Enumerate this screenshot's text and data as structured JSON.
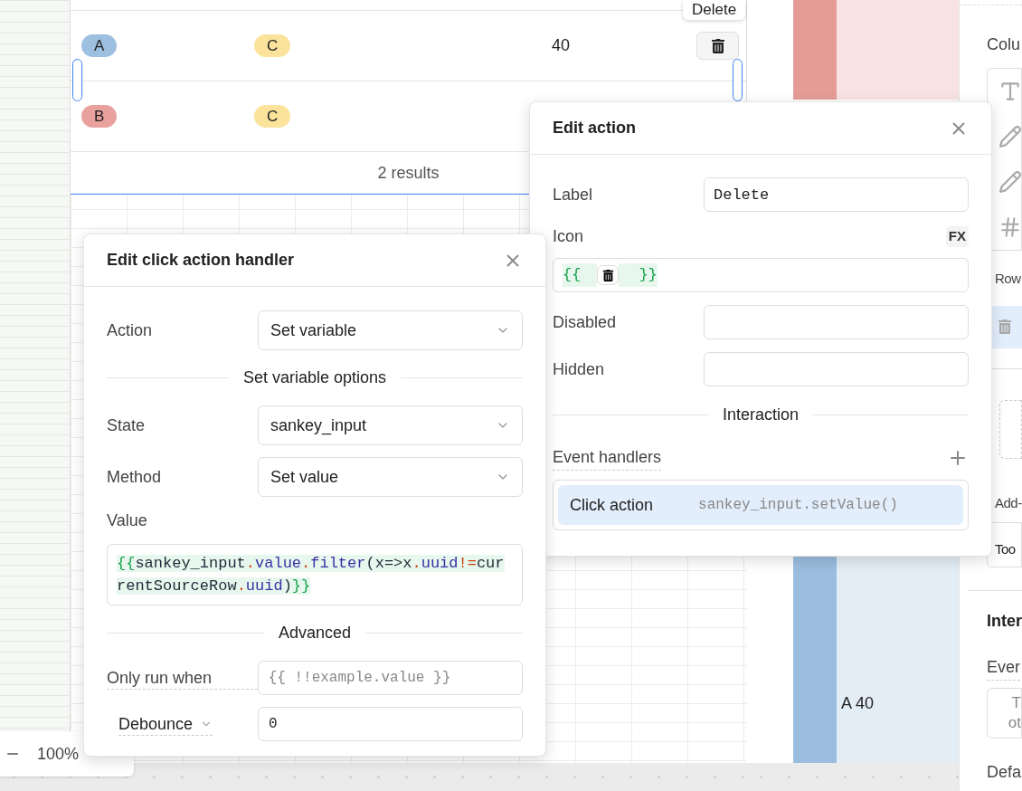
{
  "tooltip": {
    "text": "Delete"
  },
  "table": {
    "rows": [
      {
        "tag_1": {
          "text": "A",
          "color": "#9dc0e0"
        },
        "tag_2": {
          "text": "C",
          "color": "#fbe39b"
        },
        "value": "40",
        "delete_button": true
      },
      {
        "tag_1": {
          "text": "B",
          "color": "#e8a19c"
        },
        "tag_2": {
          "text": "C",
          "color": "#fbe39b"
        },
        "delete_button": false
      }
    ],
    "footer": "2 results"
  },
  "chart": {
    "nodes": [
      {
        "color": "#e59c97"
      },
      {
        "color": "#9bbddf",
        "label": "A 40"
      }
    ]
  },
  "zoom_control": {
    "value": "100%"
  },
  "sidebar": {
    "section_1": "Colu",
    "section_2": "Row",
    "section_3": "Add-",
    "field_1": "Too",
    "section_4": "Inter",
    "label_1": "Ever",
    "note_lines": [
      "T",
      "ot"
    ],
    "label_2": "Defa"
  },
  "action_dialog": {
    "title": "Edit action",
    "fields": [
      {
        "kind": "input",
        "label": "Label",
        "value": "Delete"
      },
      {
        "kind": "icon",
        "label": "Icon",
        "badge": "FX",
        "open": "{{",
        "close": "}}"
      },
      {
        "kind": "input",
        "label": "Disabled"
      },
      {
        "kind": "input",
        "label": "Hidden"
      },
      {
        "kind": "divider",
        "label": "Interaction"
      }
    ],
    "event_handlers": {
      "label": "Event handlers",
      "items": [
        {
          "name": "Click action",
          "detail": "sankey_input.setValue()",
          "selected": true
        }
      ]
    }
  },
  "handler_dialog": {
    "title": "Edit click action handler",
    "fields": [
      {
        "kind": "select",
        "label": "Action",
        "value": "Set variable"
      },
      {
        "kind": "divider",
        "label": "Set variable options"
      },
      {
        "kind": "select",
        "label": "State",
        "value": "sankey_input"
      },
      {
        "kind": "select",
        "label": "Method",
        "value": "Set value"
      },
      {
        "kind": "code",
        "label": "Value",
        "value": "{{sankey_input.value.filter(x=>x.uuid!=currentSourceRow.uuid)}}"
      },
      {
        "kind": "divider",
        "label": "Advanced"
      },
      {
        "kind": "input",
        "label": "Only run when",
        "placeholder": "{{ !!example.value }}"
      },
      {
        "kind": "dropdown_input",
        "label": "Debounce",
        "value": "0"
      }
    ]
  }
}
